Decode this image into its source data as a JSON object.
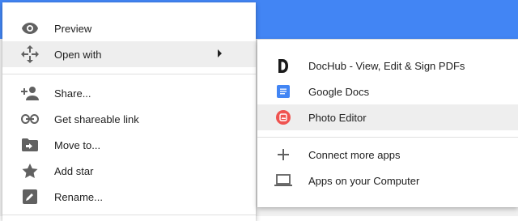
{
  "colors": {
    "topbar": "#4285f4",
    "icon_gray": "#616161",
    "docs_blue": "#4285f4",
    "photo_editor_red": "#ef5350",
    "highlight": "#eeeeee"
  },
  "main_menu": {
    "items": [
      {
        "label": "Preview",
        "icon": "eye-icon"
      },
      {
        "label": "Open with",
        "icon": "move-arrows-icon",
        "has_submenu": true
      },
      {
        "label": "Share...",
        "icon": "person-add-icon"
      },
      {
        "label": "Get shareable link",
        "icon": "link-icon"
      },
      {
        "label": "Move to...",
        "icon": "folder-move-icon"
      },
      {
        "label": "Add star",
        "icon": "star-icon"
      },
      {
        "label": "Rename...",
        "icon": "pencil-icon"
      }
    ],
    "highlighted": "Open with"
  },
  "submenu": {
    "apps": [
      {
        "label": "DocHub - View, Edit & Sign PDFs",
        "icon": "dochub-icon"
      },
      {
        "label": "Google Docs",
        "icon": "google-docs-icon"
      },
      {
        "label": "Photo Editor",
        "icon": "photo-editor-icon"
      }
    ],
    "actions": [
      {
        "label": "Connect more apps",
        "icon": "plus-icon"
      },
      {
        "label": "Apps on your Computer",
        "icon": "laptop-icon"
      }
    ],
    "highlighted": "Photo Editor"
  }
}
